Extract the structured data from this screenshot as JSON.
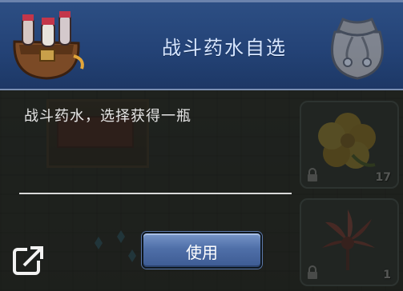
{
  "dialog": {
    "title": "战斗药水自选",
    "description": "战斗药水，选择获得一瓶",
    "use_button_label": "使用"
  },
  "icons": {
    "header_left": "potion-bag-icon",
    "header_right": "pouch-icon",
    "share": "share-icon"
  },
  "slots": [
    {
      "item": "yellow-flower",
      "locked": true,
      "count": "17"
    },
    {
      "item": "red-leaf-plant",
      "locked": true,
      "count": "1"
    }
  ],
  "colors": {
    "header": "#244377",
    "button": "#4f6fa8",
    "title_text": "#d7e6ff"
  }
}
